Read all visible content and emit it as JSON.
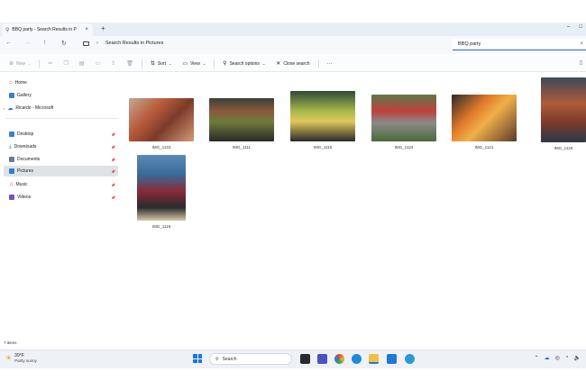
{
  "window": {
    "tab_title": "BBQ party - Search Results in P",
    "tab_close": "×",
    "new_tab": "+",
    "controls": [
      "–",
      "□"
    ]
  },
  "address": {
    "back": "←",
    "forward": "→",
    "up": "↑",
    "refresh": "↻",
    "breadcrumb_sep": "›",
    "breadcrumb_text": "Search Results in Pictures",
    "search_value": "BBQ party",
    "search_clear": "×"
  },
  "toolbar": {
    "new_label": "New",
    "sort_label": "Sort",
    "view_label": "View",
    "search_options_label": "Search options",
    "close_search_label": "Close search",
    "more_label": "···"
  },
  "sidebar": {
    "home": "Home",
    "gallery": "Gallery",
    "ricardo": "Ricardo - Microsoft",
    "desktop": "Desktop",
    "downloads": "Downloads",
    "documents": "Documents",
    "pictures": "Pictures",
    "music": "Music",
    "videos": "Videos"
  },
  "files": [
    {
      "name": "IMG_1123"
    },
    {
      "name": "IMG_1111"
    },
    {
      "name": "IMG_1116"
    },
    {
      "name": "IMG_1124"
    },
    {
      "name": "IMG_1121"
    },
    {
      "name": "IMG_1120"
    },
    {
      "name": "IMG_1119"
    }
  ],
  "status": {
    "count_text": "7 items"
  },
  "taskbar": {
    "temp": "39°F",
    "weather_desc": "Partly sunny",
    "search_label": "Search"
  },
  "colors": {
    "accent": "#2563eb",
    "selected_bg": "#dfe3e8",
    "titlebar_bg": "#e8eef6"
  }
}
